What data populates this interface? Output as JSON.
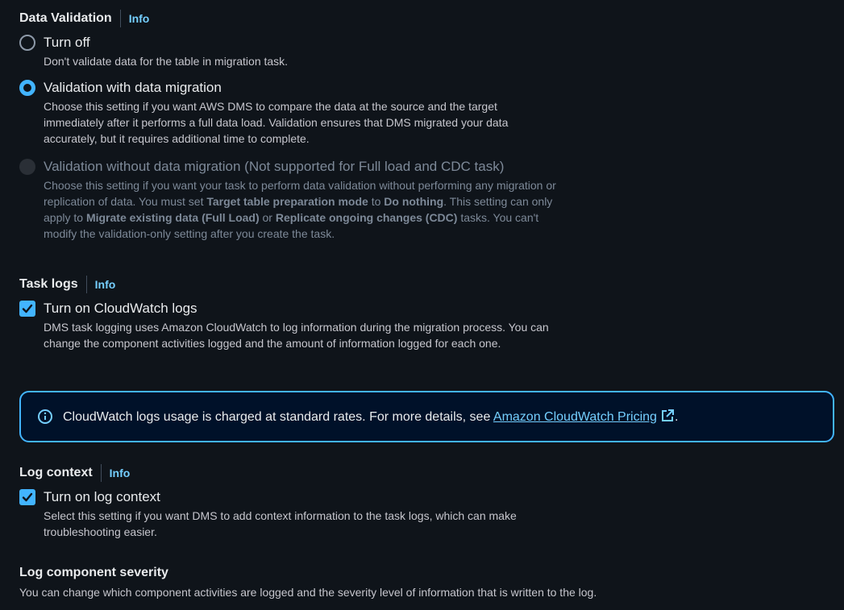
{
  "data_validation": {
    "title": "Data Validation",
    "info": "Info",
    "options": [
      {
        "label": "Turn off",
        "desc": "Don't validate data for the table in migration task."
      },
      {
        "label": "Validation with data migration",
        "desc": "Choose this setting if you want AWS DMS to compare the data at the source and the target immediately after it performs a full data load. Validation ensures that DMS migrated your data accurately, but it requires additional time to complete."
      },
      {
        "label": "Validation without data migration (Not supported for Full load and CDC task)",
        "desc_parts": [
          "Choose this setting if you want your task to perform data validation without performing any migration or replication of data. You must set ",
          "Target table preparation mode",
          " to ",
          "Do nothing",
          ". This setting can only apply to ",
          "Migrate existing data (Full Load)",
          " or ",
          "Replicate ongoing changes (CDC)",
          " tasks. You can't modify the validation-only setting after you create the task."
        ]
      }
    ],
    "selected": "Validation with data migration"
  },
  "task_logs": {
    "title": "Task logs",
    "info": "Info",
    "checkbox_label": "Turn on CloudWatch logs",
    "checked": true,
    "desc": "DMS task logging uses Amazon CloudWatch to log information during the migration process. You can change the component activities logged and the amount of information logged for each one."
  },
  "alert": {
    "text": "CloudWatch logs usage is charged at standard rates. For more details, see ",
    "link": "Amazon CloudWatch Pricing",
    "suffix": "."
  },
  "log_context": {
    "title": "Log context",
    "info": "Info",
    "checkbox_label": "Turn on log context",
    "checked": true,
    "desc": "Select this setting if you want DMS to add context information to the task logs, which can make troubleshooting easier."
  },
  "log_component_severity": {
    "title": "Log component severity",
    "desc": "You can change which component activities are logged and the severity level of information that is written to the log."
  },
  "icons": {
    "info": "info-circle-icon",
    "external": "external-link-icon",
    "check": "check-icon"
  },
  "colors": {
    "accent": "#42b4ff",
    "link": "#75cfff",
    "background": "#0f141a",
    "alert_bg": "#001129"
  }
}
